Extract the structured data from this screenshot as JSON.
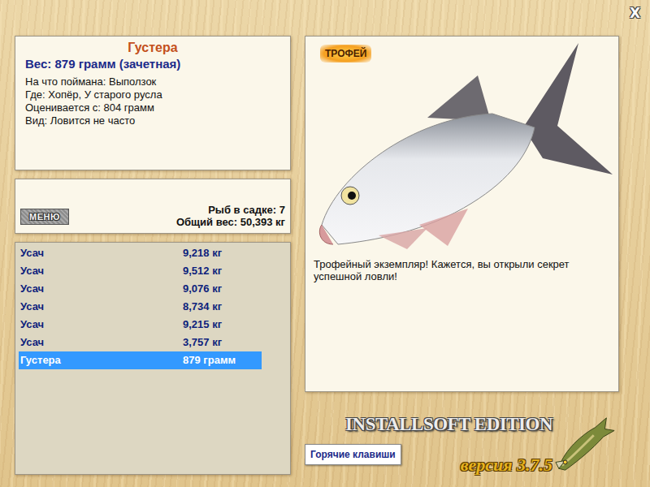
{
  "window": {
    "close": "X"
  },
  "fish": {
    "name": "Густера",
    "weight": "Вес: 879 грамм (зачетная)",
    "details": [
      "На что поймана: Выползок",
      "Где: Хопёр, У старого русла",
      "Оценивается с: 804 грамм",
      "Вид: Ловится не часто"
    ]
  },
  "menu_button": "МЕНЮ",
  "keepnet": {
    "count": "Рыб в садке: 7",
    "total": "Общий вес: 50,393 кг"
  },
  "catch_list": [
    {
      "name": "Усач",
      "weight": "9,218 кг",
      "selected": false
    },
    {
      "name": "Усач",
      "weight": "9,512 кг",
      "selected": false
    },
    {
      "name": "Усач",
      "weight": "9,076 кг",
      "selected": false
    },
    {
      "name": "Усач",
      "weight": "8,734 кг",
      "selected": false
    },
    {
      "name": "Усач",
      "weight": "9,215 кг",
      "selected": false
    },
    {
      "name": "Усач",
      "weight": "3,757 кг",
      "selected": false
    },
    {
      "name": "Густера",
      "weight": "879 грамм",
      "selected": true
    }
  ],
  "trophy": {
    "badge": "ТРОФЕЙ",
    "description": "Трофейный экземпляр! Кажется, вы открыли секрет успешной ловли!"
  },
  "hotkeys_button": "Горячие клавиши",
  "logo": {
    "title": "INSTALLSOFT EDITION",
    "version": "версия 3.7.5"
  }
}
